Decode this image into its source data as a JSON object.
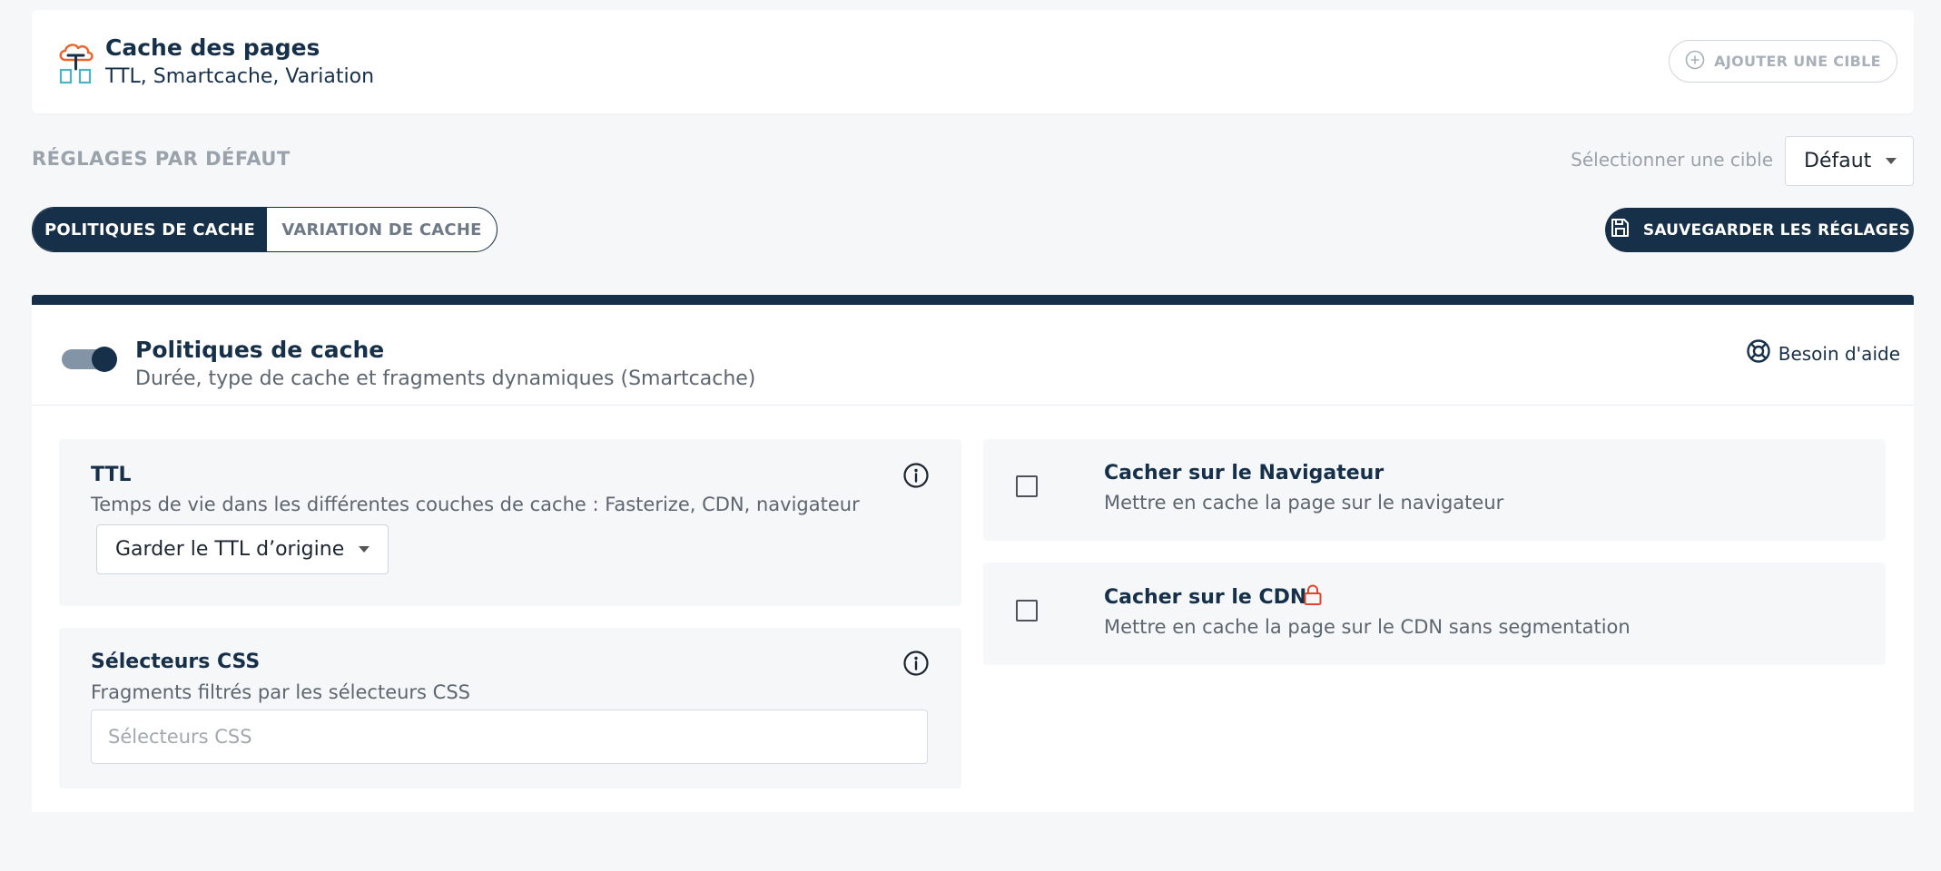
{
  "header": {
    "logo_icon": "cloud-cache-icon",
    "title": "Cache des pages",
    "subtitle": "TTL, Smartcache, Variation",
    "add_target_icon": "plus-circle-icon",
    "add_target_label": "AJOUTER UNE CIBLE"
  },
  "settings": {
    "section_label": "RÉGLAGES PAR DÉFAUT",
    "select_target_label": "Sélectionner une cible",
    "select_target_value": "Défaut"
  },
  "tabs": [
    {
      "label": "POLITIQUES DE CACHE",
      "active": true
    },
    {
      "label": "VARIATION DE CACHE",
      "active": false
    }
  ],
  "save_button": {
    "icon": "floppy-disk-icon",
    "label": "SAUVEGARDER LES RÉGLAGES"
  },
  "panel": {
    "enabled": true,
    "title": "Politiques de cache",
    "subtitle": "Durée, type de cache et fragments dynamiques (Smartcache)",
    "help_icon": "lifebuoy-icon",
    "help_label": "Besoin d'aide"
  },
  "ttl": {
    "title": "TTL",
    "description": "Temps de vie dans les différentes couches de cache : Fasterize, CDN, navigateur",
    "select_value": "Garder le TTL d’origine",
    "info_icon": "info-circle-icon"
  },
  "css_selectors": {
    "title": "Sélecteurs CSS",
    "description": "Fragments filtrés par les sélecteurs CSS",
    "placeholder": "Sélecteurs CSS",
    "value": "",
    "info_icon": "info-circle-icon"
  },
  "browser_cache": {
    "checked": false,
    "title": "Cacher sur le Navigateur",
    "description": "Mettre en cache la page sur le navigateur"
  },
  "cdn_cache": {
    "checked": false,
    "title": "Cacher sur le CDN",
    "description": "Mettre en cache la page sur le CDN sans segmentation",
    "lock_icon": "lock-icon",
    "lock_color": "#e0442e"
  },
  "colors": {
    "primary": "#17304a",
    "background": "#f6f7f9",
    "muted": "#9aa2ab"
  }
}
